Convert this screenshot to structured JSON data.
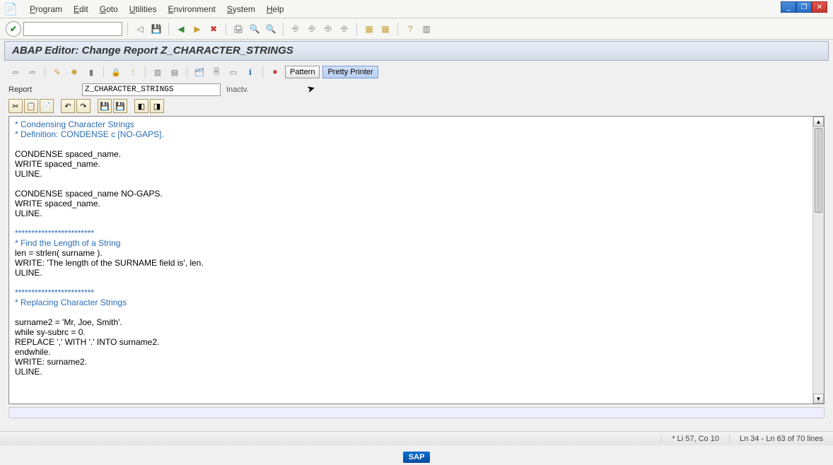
{
  "window": {
    "min": "_",
    "max": "❐",
    "close": "✕"
  },
  "menu": {
    "file_icon": "📄",
    "items": [
      "Program",
      "Edit",
      "Goto",
      "Utilities",
      "Environment",
      "System",
      "Help"
    ]
  },
  "toolbar": {
    "check": "✔",
    "combo": "",
    "back": "◁",
    "save": "💾",
    "nav_back": "◀",
    "nav_fwd": "▶",
    "cancel": "✖",
    "print": "🖨",
    "find": "🔍",
    "find_next": "🔍",
    "g1": "⎆",
    "g2": "⎆",
    "g3": "⎆",
    "g4": "⎆",
    "layout1": "▦",
    "layout2": "▦",
    "help": "?",
    "extra": "▥"
  },
  "title": "ABAP Editor: Change Report Z_CHARACTER_STRINGS",
  "subtoolbar": {
    "left": "⇦",
    "right": "⇨",
    "check2": "✎",
    "activate": "✺",
    "exec": "▮",
    "b1": "🔒",
    "b2": "🕯",
    "b3": "▥",
    "b4": "▤",
    "b5": "🗂",
    "b6": "🗎",
    "b7": "▭",
    "b8": "ℹ",
    "stop": "⏹",
    "pattern": "Pattern",
    "pretty": "Pretty Printer"
  },
  "report": {
    "label": "Report",
    "value": "Z_CHARACTER_STRINGS",
    "status": "Inactv."
  },
  "editor_btns": {
    "b1": "✂",
    "b2": "📋",
    "b3": "📄",
    "b4": "↶",
    "b5": "↷",
    "b6": "💾",
    "b7": "💾",
    "b8": "◧",
    "b9": "◨"
  },
  "code": [
    {
      "t": "comment",
      "v": "* Condensing Character Strings"
    },
    {
      "t": "comment",
      "v": "* Definition: CONDENSE c [NO-GAPS]."
    },
    {
      "t": "normal",
      "v": ""
    },
    {
      "t": "normal",
      "v": "CONDENSE spaced_name."
    },
    {
      "t": "normal",
      "v": "WRITE spaced_name."
    },
    {
      "t": "normal",
      "v": "ULINE."
    },
    {
      "t": "normal",
      "v": ""
    },
    {
      "t": "normal",
      "v": "CONDENSE spaced_name NO-GAPS."
    },
    {
      "t": "normal",
      "v": "WRITE spaced_name."
    },
    {
      "t": "normal",
      "v": "ULINE."
    },
    {
      "t": "normal",
      "v": ""
    },
    {
      "t": "comment",
      "v": "************************"
    },
    {
      "t": "comment",
      "v": "* Find the Length of a String"
    },
    {
      "t": "normal",
      "v": "len = strlen( surname )."
    },
    {
      "t": "normal",
      "v": "WRITE: 'The length of the SURNAME field is', len."
    },
    {
      "t": "normal",
      "v": "ULINE."
    },
    {
      "t": "normal",
      "v": ""
    },
    {
      "t": "comment",
      "v": "************************"
    },
    {
      "t": "comment",
      "v": "* Replacing Character Strings"
    },
    {
      "t": "normal",
      "v": ""
    },
    {
      "t": "normal",
      "v": "surname2 = 'Mr, Joe, Smith'."
    },
    {
      "t": "normal",
      "v": "while sy-subrc = 0."
    },
    {
      "t": "normal",
      "v": "REPLACE ',' WITH '.' INTO surname2."
    },
    {
      "t": "normal",
      "v": "endwhile."
    },
    {
      "t": "normal",
      "v": "WRITE: surname2."
    },
    {
      "t": "normal",
      "v": "ULINE."
    }
  ],
  "status": {
    "pos": "*  Li 57, Co 10",
    "range": "Ln 34 - Ln 63 of 70 lines"
  },
  "footer": {
    "logo": "SAP"
  }
}
